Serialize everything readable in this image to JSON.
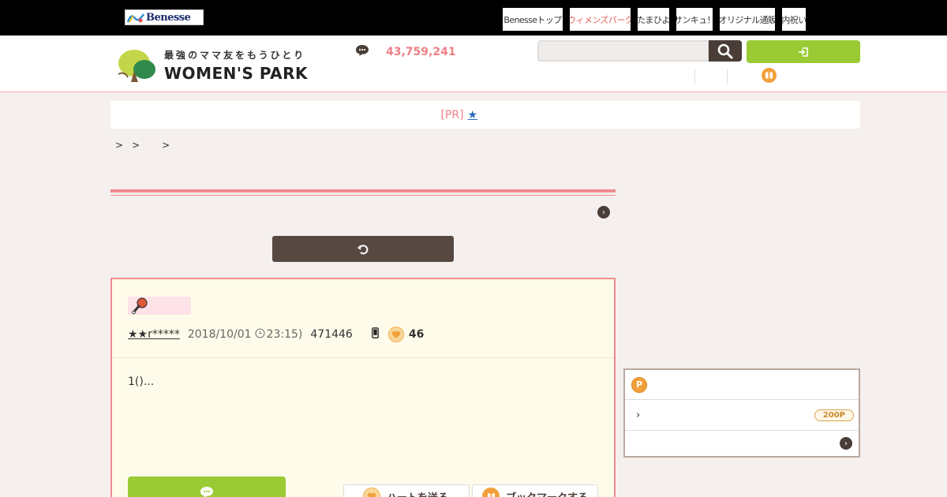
{
  "topbar": {
    "logo_text": "Benesse",
    "nav": [
      {
        "label": "Benesseトップ",
        "active": false
      },
      {
        "label": "ウィメンズパーク",
        "active": true
      },
      {
        "label": "たまひよ",
        "active": false
      },
      {
        "label": "サンキュ！",
        "active": false
      },
      {
        "label": "オリジナル通販",
        "active": false
      },
      {
        "label": "内祝い",
        "active": false
      }
    ]
  },
  "header": {
    "tagline": "最強のママ友をもうひとり",
    "site_name": "WOMEN'S PARK",
    "post_count": "43,759,241",
    "search_placeholder": "",
    "login_label": ""
  },
  "pr": {
    "label": "[PR]",
    "link_text": "★"
  },
  "breadcrumb": {
    "separators": [
      ">",
      ">",
      ">"
    ]
  },
  "post": {
    "author": "★★r*****",
    "date": "2018/10/01",
    "time": "23:15)",
    "id": "471446",
    "hearts": "46",
    "body": "1()...",
    "heart_button": "ハートを送る",
    "bookmark_button": "ブックマークする"
  },
  "points": {
    "badge": "200P"
  },
  "colors": {
    "accent_pink": "#ef7f86",
    "accent_green": "#9acb34",
    "dark_brown": "#4a3d37",
    "orange": "#f2a03b"
  }
}
